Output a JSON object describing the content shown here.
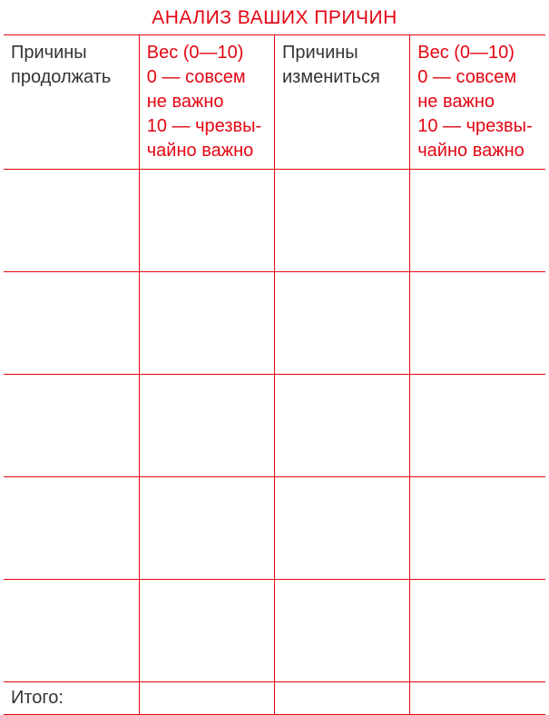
{
  "title": "АНАЛИЗ ВАШИХ ПРИЧИН",
  "headers": {
    "col1": "Причины продолжать",
    "col2": "Вес (0—10)\n0 — совсем не важно\n10 — чрезвы­чайно важно",
    "col3": "Причины измениться",
    "col4": "Вес (0—10)\n0 — совсем не важно\n10 — чрезвы­чайно важно"
  },
  "rows": [
    {
      "c1": "",
      "c2": "",
      "c3": "",
      "c4": ""
    },
    {
      "c1": "",
      "c2": "",
      "c3": "",
      "c4": ""
    },
    {
      "c1": "",
      "c2": "",
      "c3": "",
      "c4": ""
    },
    {
      "c1": "",
      "c2": "",
      "c3": "",
      "c4": ""
    },
    {
      "c1": "",
      "c2": "",
      "c3": "",
      "c4": ""
    }
  ],
  "totals": {
    "label": "Итого:",
    "c2": "",
    "c3": "",
    "c4": ""
  }
}
